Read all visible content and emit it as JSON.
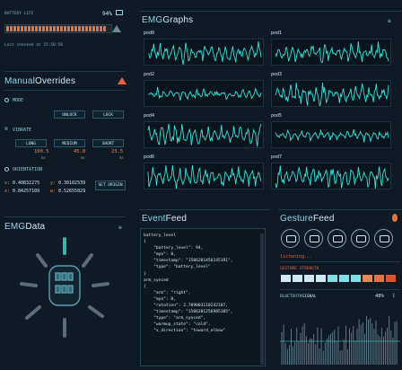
{
  "battery": {
    "label": "BATTERY LIFE",
    "percent": "94%",
    "level": 0.94,
    "last_checked": "Last checked at 15:50:58"
  },
  "manual_overrides": {
    "title_a": "Manual",
    "title_b": "Overrides",
    "mode": {
      "label": "MODE",
      "unlock": "UNLOCK",
      "lock": "LOCK"
    },
    "vibrate": {
      "label": "VIBRATE",
      "long": "LONG",
      "medium": "MEDIUM",
      "short": "SHORT",
      "long_val": "100.5",
      "medium_val": "45.8",
      "short_val": "23.5",
      "unit": "ms"
    },
    "orientation": {
      "label": "ORIENTATION",
      "x_label": "x:",
      "x": "0.40832275",
      "y_label": "y:",
      "y": "0.30102539",
      "z_label": "z:",
      "z": "0.84257109",
      "w_label": "w:",
      "w": "0.52655029",
      "set_origin": "SET ORIGIN"
    }
  },
  "emg_graphs": {
    "title_a": "EMG",
    "title_b": "Graphs",
    "pods": [
      "pod0",
      "pod1",
      "pod2",
      "pod3",
      "pod4",
      "pod5",
      "pod6",
      "pod7"
    ]
  },
  "emg_data": {
    "title_a": "EMG",
    "title_b": "Data"
  },
  "event_feed": {
    "title_a": "Event",
    "title_b": "Feed",
    "lines": [
      "battery_level",
      "{",
      "    \"battery_level\": 94,",
      "    \"myo\": 0,",
      "    \"timestamp\": \"1506201456145191\",",
      "    \"type\": \"battery_level\"",
      "}",
      "arm_synced",
      "{",
      "    \"arm\": \"right\",",
      "    \"myo\": 0,",
      "    \"rotation\": 2.709003110242107,",
      "    \"timestamp\": \"1506201256985105\",",
      "    \"type\": \"arm_synced\",",
      "    \"warmup_state\": \"cold\",",
      "    \"x_direction\": \"toward_elbow\""
    ]
  },
  "gesture_feed": {
    "title_a": "Gesture",
    "title_b": "Feed",
    "status": "listening...",
    "strength_label": "GESTURE STRENGTH",
    "bluetooth_label_a": "BLUETOOTH",
    "bluetooth_label_b": "SIGNAL",
    "bluetooth_value": "48%",
    "strength_colors": [
      "#cfeaf2",
      "#cfeaf2",
      "#cfeaf2",
      "#cfeaf2",
      "#7fe0ea",
      "#7fe0ea",
      "#7fe0ea",
      "#e28a57",
      "#e2733f",
      "#d9552f"
    ]
  },
  "colors": {
    "accent": "#35e0d8",
    "warning": "#e8603f",
    "text": "#cfeaf2"
  }
}
